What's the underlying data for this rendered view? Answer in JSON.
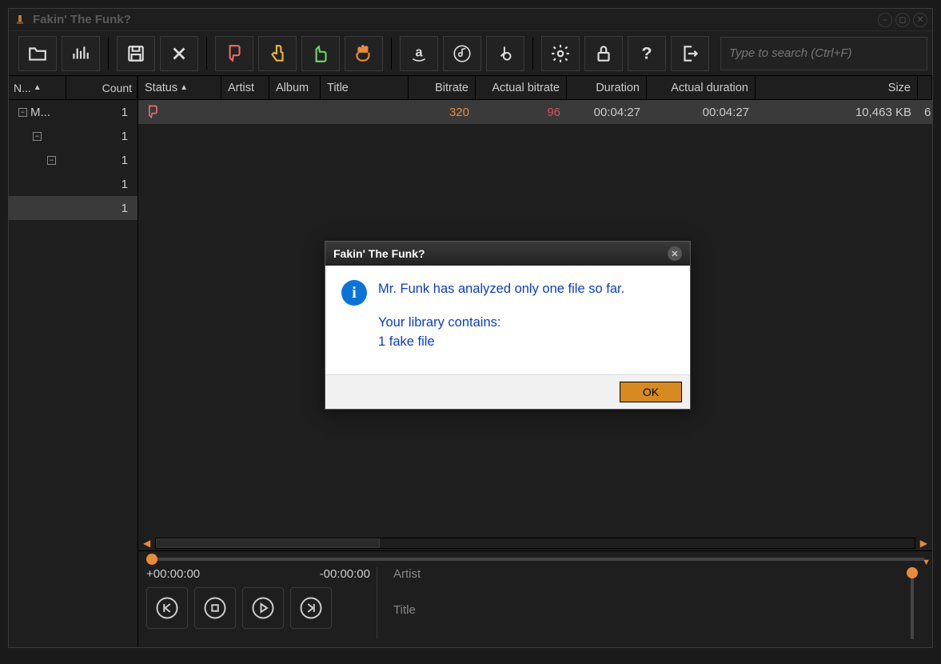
{
  "window": {
    "title": "Fakin' The Funk?"
  },
  "search": {
    "placeholder": "Type to search (Ctrl+F)"
  },
  "tree": {
    "headers": {
      "name": "N...",
      "count": "Count"
    },
    "rows": [
      {
        "label": "M...",
        "count": "1",
        "indent": 0,
        "toggle": true
      },
      {
        "label": "",
        "count": "1",
        "indent": 1,
        "toggle": true
      },
      {
        "label": "",
        "count": "1",
        "indent": 2,
        "toggle": true
      },
      {
        "label": "",
        "count": "1",
        "indent": 3,
        "toggle": false
      },
      {
        "label": "",
        "count": "1",
        "indent": 2,
        "toggle": false,
        "selected": true
      }
    ]
  },
  "grid": {
    "columns": {
      "status": "Status",
      "artist": "Artist",
      "album": "Album",
      "title": "Title",
      "bitrate": "Bitrate",
      "actual_bitrate": "Actual bitrate",
      "duration": "Duration",
      "actual_duration": "Actual duration",
      "size": "Size"
    },
    "rows": [
      {
        "status": "thumbs-down",
        "artist": "",
        "album": "",
        "title": "",
        "bitrate": "320",
        "actual_bitrate": "96",
        "duration": "00:04:27",
        "actual_duration": "00:04:27",
        "size": "10,463 KB",
        "trail": "6"
      }
    ]
  },
  "player": {
    "elapsed": "+00:00:00",
    "remaining": "-00:00:00",
    "artist_label": "Artist",
    "title_label": "Title"
  },
  "dialog": {
    "title": "Fakin' The Funk?",
    "line1": "Mr. Funk has analyzed only one file so far.",
    "line2": "Your library contains:",
    "line3": "1 fake file",
    "ok": "OK"
  },
  "colors": {
    "accent": "#e88b3a"
  }
}
